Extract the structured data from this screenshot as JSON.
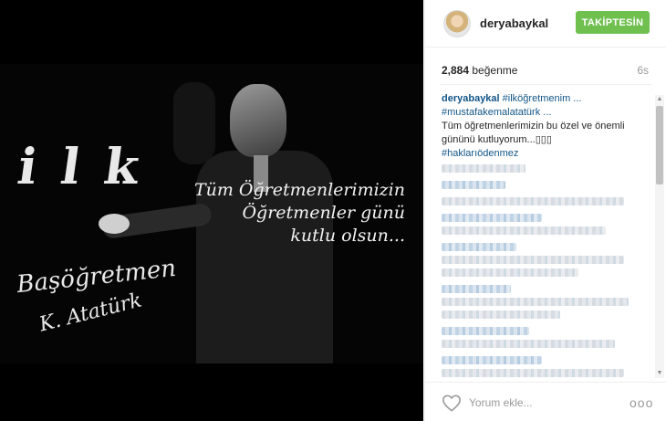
{
  "post": {
    "image_text": {
      "chalk_letters": "i l k",
      "signature_title": "Başöğretmen",
      "signature_name": "K. Atatürk",
      "quote_line1": "Tüm Öğretmenlerimizin",
      "quote_line2": "Öğretmenler günü",
      "quote_line3": "kutlu olsun..."
    }
  },
  "header": {
    "username": "deryabaykal",
    "follow_label": "TAKİPTESİN"
  },
  "stats": {
    "likes_count": "2,884",
    "likes_word": "beğenme",
    "age": "6s"
  },
  "caption": {
    "username": "deryabaykal",
    "tag1": "#ilköğretmenim ...",
    "tag2": "#mustafakemalatatürk ...",
    "text": "Tüm öğretmenlerimizin bu özel ve önemli gününü kutluyorum...▯▯▯",
    "tag3": "#haklarıödenmez"
  },
  "footer": {
    "comment_placeholder": "Yorum ekle...",
    "more_label": "ooo"
  },
  "colors": {
    "follow_green": "#70c050",
    "link_blue": "#125688"
  },
  "icons": {
    "heart": "heart-icon",
    "more": "more-options-icon"
  }
}
